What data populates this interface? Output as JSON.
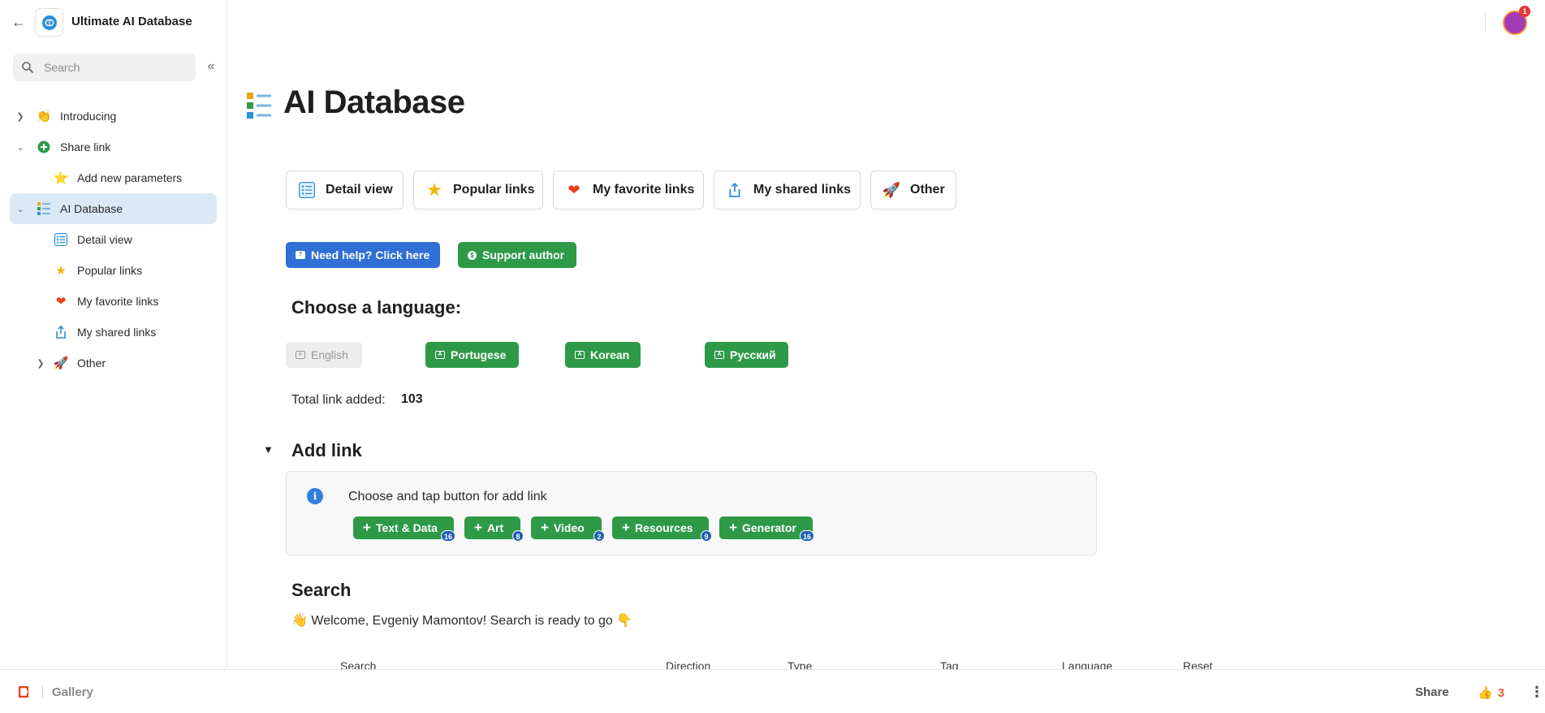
{
  "app": {
    "title": "Ultimate AI Database"
  },
  "sidebar": {
    "search_placeholder": "Search",
    "items": [
      {
        "label": "Introducing",
        "icon": "clapping-hands-icon",
        "chevron": "right"
      },
      {
        "label": "Share link",
        "icon": "green-plus-icon",
        "chevron": "down"
      },
      {
        "label": "Add new parameters",
        "icon": "star-badge-icon"
      },
      {
        "label": "AI Database",
        "icon": "checklist-icon",
        "chevron": "down",
        "active": true
      },
      {
        "label": "Detail view",
        "icon": "list-icon"
      },
      {
        "label": "Popular links",
        "icon": "star-icon"
      },
      {
        "label": "My favorite links",
        "icon": "heart-icon"
      },
      {
        "label": "My shared links",
        "icon": "share-icon"
      },
      {
        "label": "Other",
        "icon": "rocket-icon",
        "chevron": "right"
      }
    ]
  },
  "topbar": {
    "notification_count": "1"
  },
  "page": {
    "title": "AI Database",
    "nav_buttons": [
      {
        "label": "Detail view",
        "icon": "list-icon"
      },
      {
        "label": "Popular links",
        "icon": "star-icon"
      },
      {
        "label": "My favorite links",
        "icon": "heart-icon"
      },
      {
        "label": "My shared links",
        "icon": "share-icon"
      },
      {
        "label": "Other",
        "icon": "rocket-icon"
      }
    ],
    "help_button": "Need help? Click here",
    "support_button": "Support author",
    "language_heading": "Choose a language:",
    "languages": [
      "English",
      "Portugese",
      "Korean",
      "Русский"
    ],
    "selected_language": "English",
    "total_label": "Total link added:",
    "total_value": "103",
    "add_link_heading": "Add link",
    "callout_text": "Choose and tap button for add link",
    "add_buttons": [
      {
        "label": "Text & Data",
        "count": "16"
      },
      {
        "label": "Art",
        "count": "8"
      },
      {
        "label": "Video",
        "count": "2"
      },
      {
        "label": "Resources",
        "count": "9"
      },
      {
        "label": "Generator",
        "count": "16"
      }
    ],
    "search_heading": "Search",
    "welcome_text": "Welcome, Evgeniy Mamontov! Search is ready to go",
    "columns": [
      "Search",
      "Direction",
      "Type",
      "Tag",
      "Language",
      "Reset"
    ]
  },
  "footer": {
    "gallery": "Gallery",
    "share": "Share",
    "likes": "3"
  },
  "colors": {
    "blue_button": "#2f6fd6",
    "green_button": "#2e9a47",
    "active_sidebar": "#dbe9f6",
    "badge": "#1f5fb4"
  }
}
